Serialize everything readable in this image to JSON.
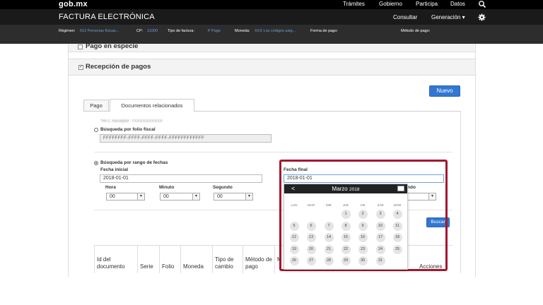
{
  "topbar": {
    "logo": "gob.mx",
    "nav": [
      "Trámites",
      "Gobierno",
      "Participa",
      "Datos"
    ],
    "search_icon": "search-icon"
  },
  "appbar": {
    "title": "FACTURA ELECTRÓNICA",
    "nav": [
      "Consultar",
      "Generación ▾"
    ],
    "settings_icon": "gear-icon"
  },
  "infobar": {
    "regimen_label": "Régimen:",
    "regimen_value": "612 Personas físicas...",
    "cp_label": "CP:",
    "cp_value": "11000",
    "tipo_label": "Tipo de factura:",
    "tipo_value": "P Pago",
    "moneda_label": "Moneda:",
    "moneda_value": "XXX Los códigos asig...",
    "forma_label": "Forma de pago:",
    "metodo_label": "Método de pago:"
  },
  "panels": {
    "especie_title": "Pago en especie",
    "recepcion_title": "Recepción de pagos"
  },
  "nuevo_label": "Nuevo",
  "tabs": [
    "Pago",
    "Documentos relacionados"
  ],
  "form": {
    "rfc_blurred": "*RFC Receptor: YXXXXXXXXXX",
    "folio_radio_label": "Búsqueda por folio fiscal",
    "folio_placeholder": "FFFFFFFF-FFFF-FFFF-FFFF-FFFFFFFFFFFF",
    "rango_radio_label": "Búsqueda por rango de fechas",
    "fecha_inicial_label": "Fecha inicial",
    "fecha_inicial_value": "2018-01-01",
    "fecha_final_label": "Fecha final",
    "fecha_final_value": "2018-01-01",
    "hora_label": "Hora",
    "minuto_label": "Minuto",
    "segundo_label": "Segundo",
    "segundo2_label": "ndo",
    "select_value": "00",
    "buscar_label": "Buscar"
  },
  "table_headers": [
    "Id del documento",
    "Serie",
    "Folio",
    "Moneda",
    "Tipo de cambio",
    "Método de pago",
    "M",
    "Acciones"
  ],
  "calendar": {
    "month": "Marzo",
    "year": "2018",
    "prev": "<",
    "dow": [
      "LUN",
      "MAR",
      "MIÉ",
      "JUE",
      "VIE",
      "SÁB",
      "DOM"
    ],
    "first_weekday_index": 3,
    "days_in_month": 31
  }
}
